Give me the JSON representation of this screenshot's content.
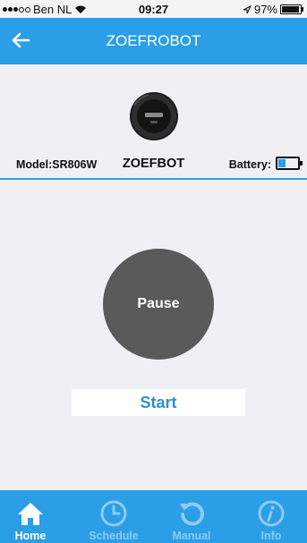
{
  "status_bar": {
    "carrier": "Ben NL",
    "time": "09:27",
    "battery_percent": "97%"
  },
  "app_bar": {
    "back_icon": "arrow-left-icon",
    "title": "ZOEFROBOT"
  },
  "robot": {
    "model_label": "Model:SR806W",
    "brand": "ZOEFBOT",
    "battery_label": "Battery:",
    "battery_level": 0.4
  },
  "controls": {
    "pause_label": "Pause",
    "start_label": "Start"
  },
  "tabs": [
    {
      "label": "Home",
      "icon": "home-icon",
      "active": true
    },
    {
      "label": "Schedule",
      "icon": "clock-icon",
      "active": false
    },
    {
      "label": "Manual",
      "icon": "rotate-icon",
      "active": false
    },
    {
      "label": "Info",
      "icon": "info-icon",
      "active": false
    }
  ],
  "colors": {
    "accent": "#2a9ee6",
    "button_gray": "#5a5a5a",
    "inactive_tab": "#8fcbf2"
  }
}
